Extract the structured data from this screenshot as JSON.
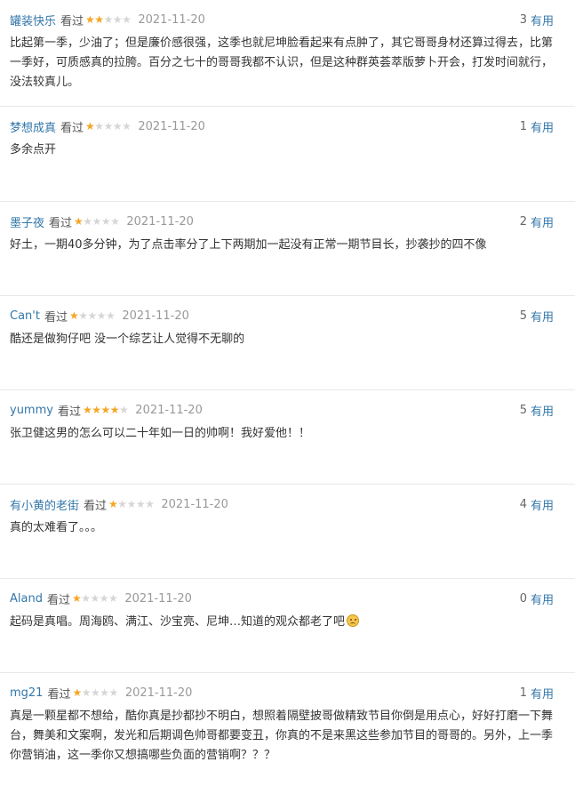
{
  "watched_label": "看过",
  "useful_label": "有用",
  "reviews": [
    {
      "author": "罐装快乐",
      "rating": 2,
      "date": "2021-11-20",
      "votes": "3",
      "content": "比起第一季，少油了；但是廉价感很强，这季也就尼坤脸看起来有点肿了，其它哥哥身材还算过得去，比第一季好，可质感真的拉胯。百分之七十的哥哥我都不认识，但是这种群英荟萃版萝卜开会，打发时间就行，没法较真儿。"
    },
    {
      "author": "梦想成真",
      "rating": 1,
      "date": "2021-11-20",
      "votes": "1",
      "content": "多余点开"
    },
    {
      "author": "墨子夜",
      "rating": 1,
      "date": "2021-11-20",
      "votes": "2",
      "content": "好土，一期40多分钟，为了点击率分了上下两期加一起没有正常一期节目长，抄袭抄的四不像"
    },
    {
      "author": "Can't",
      "rating": 1,
      "date": "2021-11-20",
      "votes": "5",
      "content": "酷还是做狗仔吧 没一个综艺让人觉得不无聊的"
    },
    {
      "author": "yummy",
      "rating": 4,
      "date": "2021-11-20",
      "votes": "5",
      "content": "张卫健这男的怎么可以二十年如一日的帅啊！我好爱他！！"
    },
    {
      "author": "有小黄的老街",
      "rating": 1,
      "date": "2021-11-20",
      "votes": "4",
      "content": "真的太难看了。。。"
    },
    {
      "author": "Aland",
      "rating": 1,
      "date": "2021-11-20",
      "votes": "0",
      "content": "起码是真唱。周海鸥、满江、沙宝亮、尼坤…知道的观众都老了吧",
      "emoji": "sad-face-icon"
    },
    {
      "author": "mg21",
      "rating": 1,
      "date": "2021-11-20",
      "votes": "1",
      "content": "真是一颗星都不想给，酷你真是抄都抄不明白，想照着隔壁披哥做精致节目你倒是用点心，好好打磨一下舞台，舞美和文案啊，发光和后期调色帅哥都要变丑，你真的不是来黑这些参加节目的哥哥的。另外，上一季你营销油，这一季你又想搞哪些负面的营销啊？？？"
    }
  ],
  "colors": {
    "author_link": "#3377aa",
    "star_on": "#f5a623",
    "star_off": "#d6d6d6",
    "date": "#999999",
    "divider": "#e8e8e8"
  }
}
